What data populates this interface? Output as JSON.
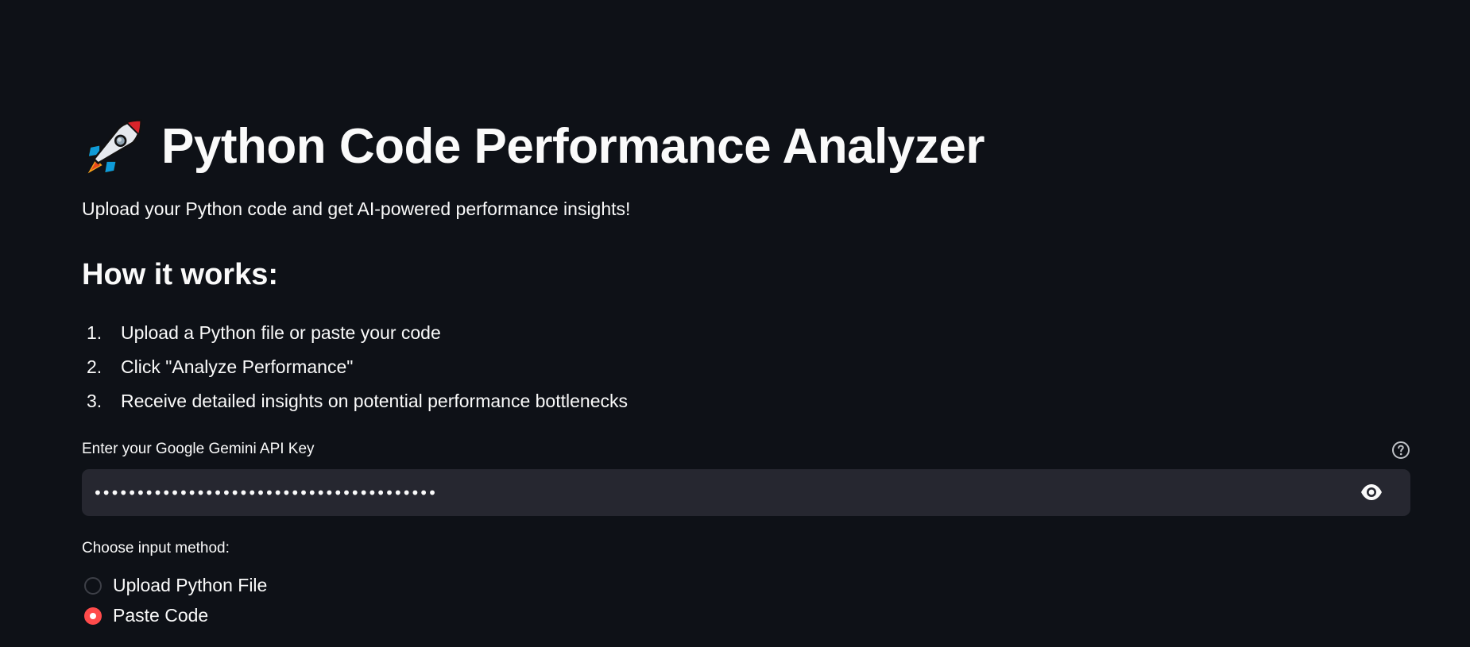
{
  "header": {
    "icon": "rocket-icon",
    "title": "Python Code Performance Analyzer",
    "subtitle": "Upload your Python code and get AI-powered performance insights!"
  },
  "how_it_works": {
    "heading": "How it works:",
    "steps": [
      {
        "num": "1.",
        "text": "Upload a Python file or paste your code"
      },
      {
        "num": "2.",
        "text": "Click \"Analyze Performance\""
      },
      {
        "num": "3.",
        "text": "Receive detailed insights on potential performance bottlenecks"
      }
    ]
  },
  "api_key": {
    "label": "Enter your Google Gemini API Key",
    "masked_value": "••••••••••••••••••••••••••••••••••••••••",
    "help_icon": "help-circle-icon",
    "toggle_icon": "eye-icon"
  },
  "input_method": {
    "label": "Choose input method:",
    "options": [
      {
        "label": "Upload Python File",
        "selected": false
      },
      {
        "label": "Paste Code",
        "selected": true
      }
    ]
  },
  "colors": {
    "background": "#0e1117",
    "input_bg": "#262730",
    "accent": "#ff4b4b",
    "text": "#fafafa"
  }
}
